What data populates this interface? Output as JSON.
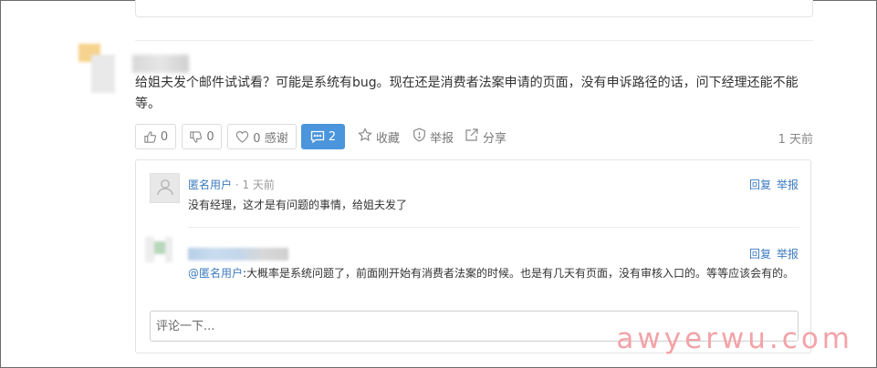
{
  "answer": {
    "text": "给姐夫发个邮件试试看？可能是系统有bug。现在还是消费者法案申请的页面，没有申诉路径的话，问下经理还能不能等。",
    "time": "1 天前"
  },
  "actions": {
    "upvote_count": "0",
    "downvote_count": "0",
    "thanks_label": "0 感谢",
    "comments_count": "2",
    "favorite_label": "收藏",
    "report_label": "举报",
    "share_label": "分享"
  },
  "comments": [
    {
      "user": "匿名用户",
      "time": "· 1 天前",
      "text": "没有经理，这才是有问题的事情，给姐夫发了",
      "reply_label": "回复",
      "report_label": "举报"
    },
    {
      "mention": "@匿名用户",
      "text": ":大概率是系统问题了，前面刚开始有消费者法案的时候。也是有几天有页面，没有审核入口的。等等应该会有的。",
      "reply_label": "回复",
      "report_label": "举报"
    }
  ],
  "comment_input": {
    "placeholder": "评论一下..."
  },
  "watermark": "awyerwu.com",
  "colors": {
    "accent": "#4a95dc",
    "link": "#3c7bc0",
    "watermark": "#f3a3a8"
  }
}
